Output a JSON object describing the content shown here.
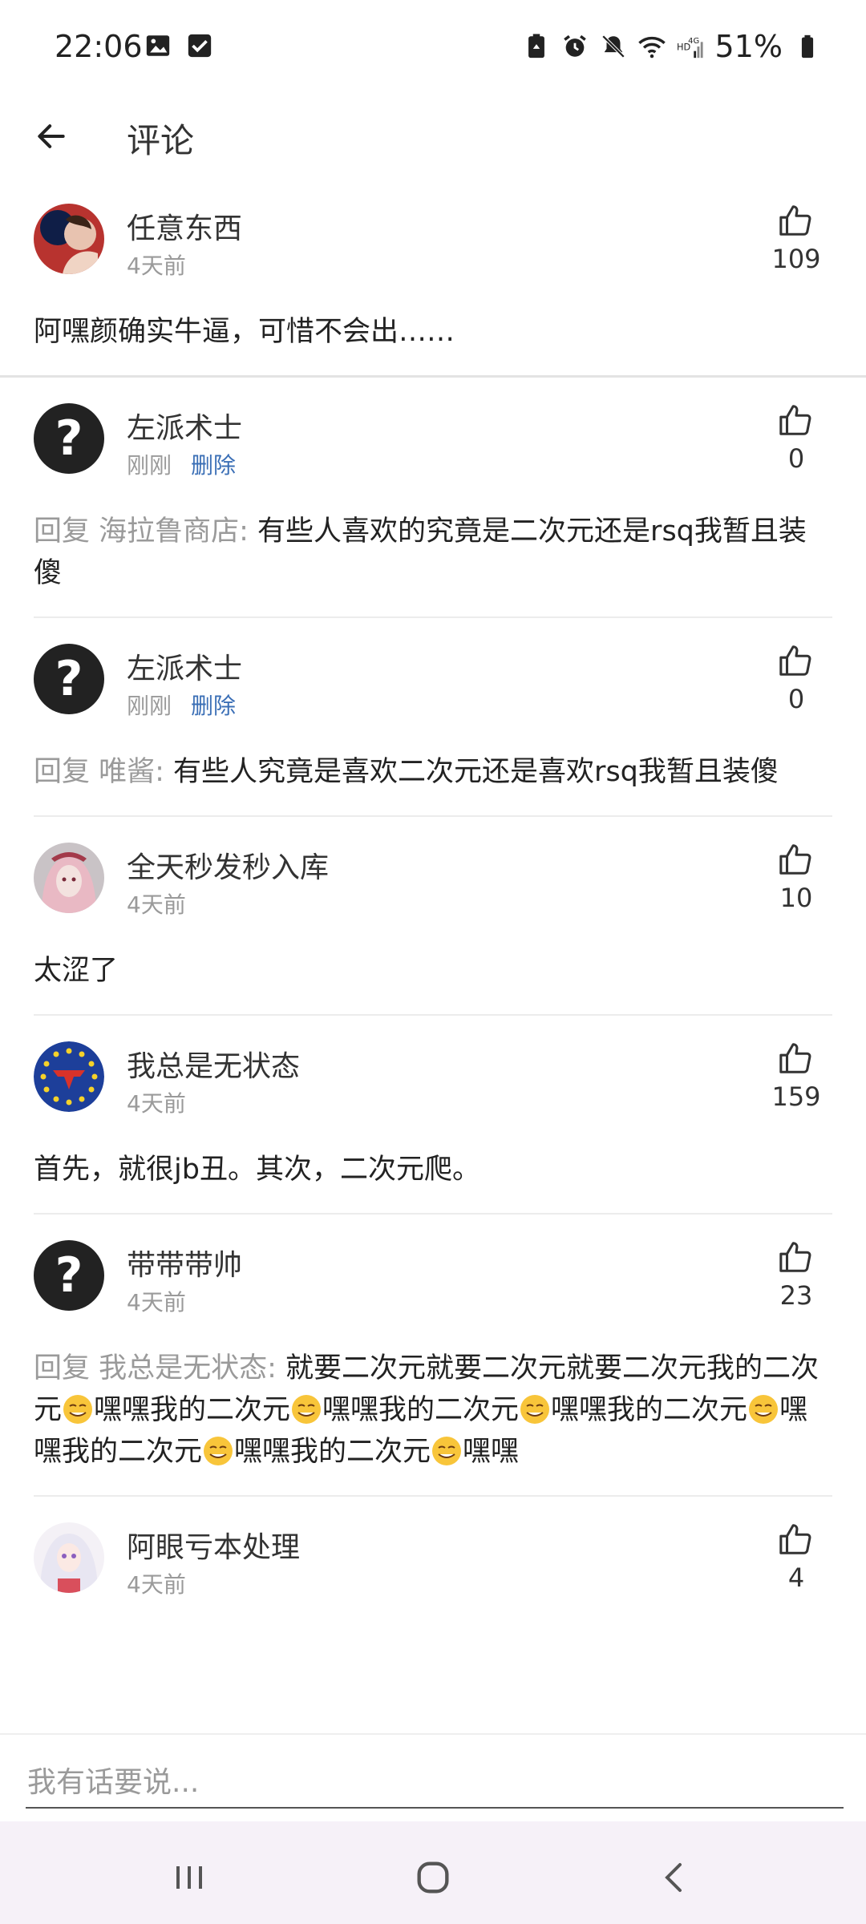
{
  "status_bar": {
    "time": "22:06",
    "battery_percent": "51%",
    "icons_left": [
      "image-icon",
      "checkbox-icon"
    ],
    "icons_right": [
      "battery-saver-icon",
      "alarm-icon",
      "mute-icon",
      "wifi-icon",
      "hd-4g-signal-icon",
      "battery-icon"
    ]
  },
  "header": {
    "title": "评论"
  },
  "comments": [
    {
      "user": "任意东西",
      "time": "4天前",
      "delete_label": "",
      "likes": "109",
      "reply_to": "",
      "text": "阿嘿颜确实牛逼，可惜不会出……"
    },
    {
      "user": "左派术士",
      "time": "刚刚",
      "delete_label": "删除",
      "likes": "0",
      "reply_to": "回复 海拉鲁商店: ",
      "text": "有些人喜欢的究竟是二次元还是rsq我暂且装傻"
    },
    {
      "user": "左派术士",
      "time": "刚刚",
      "delete_label": "删除",
      "likes": "0",
      "reply_to": "回复 唯酱: ",
      "text": "有些人究竟是喜欢二次元还是喜欢rsq我暂且装傻"
    },
    {
      "user": "全天秒发秒入库",
      "time": "4天前",
      "delete_label": "",
      "likes": "10",
      "reply_to": "",
      "text": "太涩了"
    },
    {
      "user": "我总是无状态",
      "time": "4天前",
      "delete_label": "",
      "likes": "159",
      "reply_to": "",
      "text": "首先，就很jb丑。其次，二次元爬。"
    },
    {
      "user": "带带带帅",
      "time": "4天前",
      "delete_label": "",
      "likes": "23",
      "reply_to": "回复 我总是无状态: ",
      "text_parts": [
        "就要二次元就要二次元就要二次元我的二次元",
        "嘿嘿我的二次元",
        "嘿嘿我的二次元",
        "嘿嘿我的二次元",
        "嘿嘿我的二次元",
        "嘿嘿我的二次元",
        "嘿嘿"
      ]
    },
    {
      "user": "阿眼亏本处理",
      "time": "4天前",
      "delete_label": "",
      "likes": "4",
      "reply_to": "",
      "text": ""
    }
  ],
  "input": {
    "placeholder": "我有话要说..."
  },
  "colors": {
    "accent_link": "#3b6fb6",
    "muted_text": "#9a9a9a",
    "nav_bg": "#f6f1f8"
  }
}
